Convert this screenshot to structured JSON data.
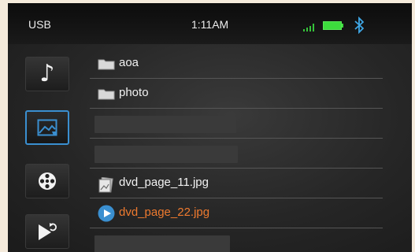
{
  "status_bar": {
    "source": "USB",
    "time": "1:11AM",
    "icons": [
      "signal-icon",
      "battery-icon",
      "bluetooth-icon"
    ]
  },
  "sidebar": {
    "items": [
      {
        "name": "music",
        "icon": "music-note-icon",
        "active": false
      },
      {
        "name": "photo",
        "icon": "picture-icon",
        "active": true
      },
      {
        "name": "video",
        "icon": "film-reel-icon",
        "active": false
      },
      {
        "name": "return",
        "icon": "return-icon",
        "active": false
      }
    ]
  },
  "files": [
    {
      "type": "folder",
      "name": "aoa"
    },
    {
      "type": "folder",
      "name": "photo"
    },
    {
      "type": "hidden",
      "name": ""
    },
    {
      "type": "hidden",
      "name": ""
    },
    {
      "type": "image",
      "name": "dvd_page_11.jpg"
    },
    {
      "type": "image",
      "name": "dvd_page_22.jpg",
      "selected": true
    },
    {
      "type": "hidden",
      "name": ""
    }
  ],
  "colors": {
    "accent_blue": "#3a8fd0",
    "selected_text": "#ee7a2f",
    "status_green": "#3ddc3d"
  }
}
